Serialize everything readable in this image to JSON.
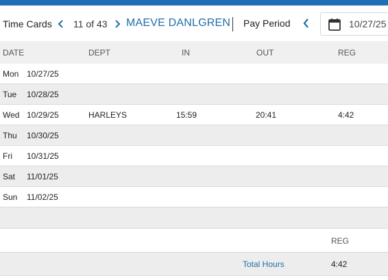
{
  "header": {
    "title": "Time Cards",
    "record_position": "11 of 43",
    "employee_name": "MAEVE DANLGREN",
    "pay_period_label": "Pay Period",
    "pay_period_date": "10/27/25"
  },
  "table": {
    "columns": [
      "DATE",
      "DEPT",
      "IN",
      "OUT",
      "REG"
    ],
    "rows": [
      {
        "day": "Mon",
        "date": "10/27/25",
        "dept": "",
        "in": "",
        "out": "",
        "reg": ""
      },
      {
        "day": "Tue",
        "date": "10/28/25",
        "dept": "",
        "in": "",
        "out": "",
        "reg": ""
      },
      {
        "day": "Wed",
        "date": "10/29/25",
        "dept": "HARLEYS",
        "in": "15:59",
        "out": "20:41",
        "reg": "4:42"
      },
      {
        "day": "Thu",
        "date": "10/30/25",
        "dept": "",
        "in": "",
        "out": "",
        "reg": ""
      },
      {
        "day": "Fri",
        "date": "10/31/25",
        "dept": "",
        "in": "",
        "out": "",
        "reg": ""
      },
      {
        "day": "Sat",
        "date": "11/01/25",
        "dept": "",
        "in": "",
        "out": "",
        "reg": ""
      },
      {
        "day": "Sun",
        "date": "11/02/25",
        "dept": "",
        "in": "",
        "out": "",
        "reg": ""
      }
    ]
  },
  "summary": {
    "reg_header": "REG",
    "total_label": "Total Hours",
    "total_reg": "4:42"
  },
  "colors": {
    "accent": "#1e6fb4",
    "link": "#1d6fa8",
    "row_alt": "#ededed",
    "header_bg": "#f0f0f0"
  },
  "icons": {
    "prev": "chevron-left-icon",
    "next": "chevron-right-icon",
    "calendar": "calendar-icon"
  }
}
